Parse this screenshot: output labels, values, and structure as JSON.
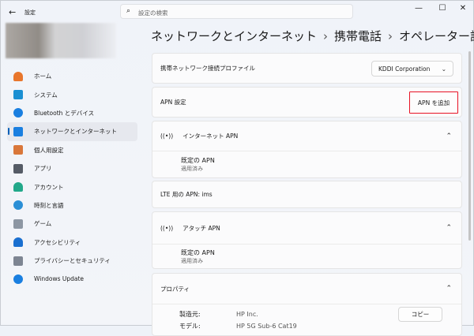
{
  "window": {
    "title": "設定",
    "back": "←",
    "minimize": "—",
    "maximize": "☐",
    "close": "✕"
  },
  "search": {
    "placeholder": "設定の検索"
  },
  "sidebar": {
    "items": [
      {
        "label": "ホーム",
        "color": "#e8762c"
      },
      {
        "label": "システム",
        "color": "#1b8fd2"
      },
      {
        "label": "Bluetooth とデバイス",
        "color": "#1a7fe0"
      },
      {
        "label": "ネットワークとインターネット",
        "color": "#1a7fe0",
        "selected": true
      },
      {
        "label": "個人用設定",
        "color": "#d9773a"
      },
      {
        "label": "アプリ",
        "color": "#555b66"
      },
      {
        "label": "アカウント",
        "color": "#22a88a"
      },
      {
        "label": "時刻と言語",
        "color": "#2b8fd6"
      },
      {
        "label": "ゲーム",
        "color": "#8d96a3"
      },
      {
        "label": "アクセシビリティ",
        "color": "#1a6fd0"
      },
      {
        "label": "プライバシーとセキュリティ",
        "color": "#7d8592"
      },
      {
        "label": "Windows Update",
        "color": "#1a7fe0"
      }
    ]
  },
  "breadcrumb": [
    "ネットワークとインターネット",
    "携帯電話",
    "オペレーター設定"
  ],
  "breadcrumb_sep": "›",
  "profile": {
    "label": "携帯ネットワーク接続プロファイル",
    "value": "KDDI Corporation"
  },
  "apn": {
    "label": "APN 設定",
    "add_button": "APN を追加"
  },
  "internet_apn": {
    "title": "インターネット APN",
    "name": "既定の APN",
    "status": "適用済み"
  },
  "lte_apn": {
    "label": "LTE 用の APN: ims"
  },
  "attach_apn": {
    "title": "アタッチ APN",
    "name": "既定の APN",
    "status": "適用済み"
  },
  "properties": {
    "title": "プロパティ",
    "copy": "コピー",
    "rows": [
      {
        "k": "製造元:",
        "v": "HP Inc."
      },
      {
        "k": "モデル:",
        "v": "HP 5G Sub-6 Cat19"
      }
    ]
  },
  "highlight_color": "#e81123"
}
